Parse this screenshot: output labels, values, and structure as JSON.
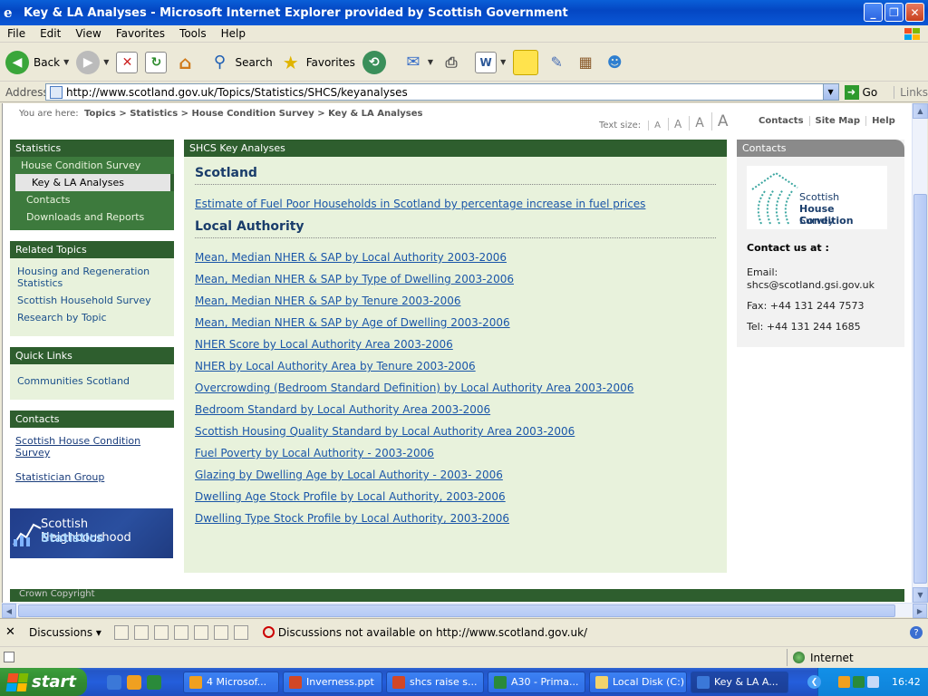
{
  "window": {
    "title": "Key & LA Analyses - Microsoft Internet Explorer provided by Scottish Government",
    "buttons": {
      "minimize": "_",
      "maximize": "❐",
      "close": "✕"
    }
  },
  "menu": [
    "File",
    "Edit",
    "View",
    "Favorites",
    "Tools",
    "Help"
  ],
  "toolbar": {
    "back": "Back",
    "search": "Search",
    "favorites": "Favorites"
  },
  "address": {
    "label": "Address",
    "url": "http://www.scotland.gov.uk/Topics/Statistics/SHCS/keyanalyses",
    "go": "Go",
    "links": "Links"
  },
  "page": {
    "breadcrumb": {
      "prefix": "You are here:",
      "trail": "Topics > Statistics > House Condition Survey > Key & LA Analyses"
    },
    "textsize": {
      "label": "Text size:",
      "s1": "A",
      "s2": "A",
      "s3": "A",
      "s4": "A"
    },
    "utilnav": [
      "Contacts",
      "Site Map",
      "Help"
    ],
    "left": {
      "statistics": {
        "heading": "Statistics",
        "items": [
          "House Condition Survey",
          "Key & LA Analyses",
          "Contacts",
          "Downloads and Reports"
        ]
      },
      "related": {
        "heading": "Related Topics",
        "items": [
          "Housing and Regeneration Statistics",
          "Scottish Household Survey",
          "Research by Topic"
        ]
      },
      "quick": {
        "heading": "Quick Links",
        "items": [
          "Communities Scotland"
        ]
      },
      "contacts": {
        "heading": "Contacts",
        "items": [
          "Scottish House Condition Survey",
          "Statistician Group"
        ]
      },
      "banner": {
        "line1": "Scottish Neighbourhood",
        "line2": "Statistics"
      }
    },
    "main": {
      "heading": "SHCS Key Analyses",
      "scotland_heading": "Scotland",
      "scotland_links": [
        "Estimate of Fuel Poor Households in Scotland by percentage increase in fuel prices"
      ],
      "la_heading": "Local Authority",
      "la_links": [
        "Mean, Median NHER & SAP by Local Authority 2003-2006",
        "Mean, Median NHER & SAP by Type of Dwelling 2003-2006",
        "Mean, Median NHER & SAP by Tenure 2003-2006",
        "Mean, Median NHER & SAP by Age of Dwelling 2003-2006",
        "NHER Score by Local Authority Area 2003-2006",
        "NHER by Local Authority Area by Tenure 2003-2006",
        "Overcrowding (Bedroom Standard Definition) by Local Authority Area 2003-2006",
        "Bedroom Standard by Local Authority Area 2003-2006",
        "Scottish Housing Quality Standard by Local Authority Area 2003-2006",
        "Fuel Poverty by Local Authority - 2003-2006",
        "Glazing by Dwelling Age by Local Authority - 2003- 2006",
        "Dwelling Age Stock Profile by Local Authority, 2003-2006",
        "Dwelling Type Stock Profile by Local Authority, 2003-2006"
      ]
    },
    "right": {
      "heading": "Contacts",
      "logo": {
        "l1": "Scottish",
        "l2": "House Condition",
        "l3": "Survey"
      },
      "contact_title": "Contact us at :",
      "email_label": "Email:",
      "email": "shcs@scotland.gsi.gov.uk",
      "fax": "Fax: +44 131 244 7573",
      "tel": "Tel: +44 131 244 1685"
    },
    "footer": "Crown Copyright"
  },
  "discussions": {
    "label": "Discussions ▾",
    "message": "Discussions not available on http://www.scotland.gov.uk/"
  },
  "status": {
    "zone": "Internet"
  },
  "taskbar": {
    "start": "start",
    "tasks": [
      "4 Microsof...",
      "Inverness.ppt",
      "shcs raise s...",
      "A30 - Prima...",
      "Local Disk (C:)",
      "Key & LA A..."
    ],
    "clock": "16:42"
  },
  "colors": {
    "accent_green": "#2e5e2e",
    "panel_bg": "#e8f2dc",
    "link_blue": "#1a56a8"
  }
}
